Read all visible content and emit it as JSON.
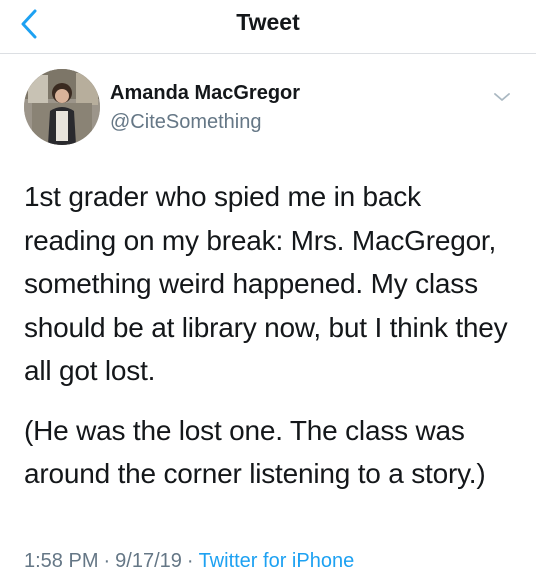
{
  "header": {
    "title": "Tweet",
    "back_icon": "chevron-left-icon",
    "accent_color": "#1da1f2"
  },
  "author": {
    "name": "Amanda MacGregor",
    "handle": "@CiteSomething",
    "menu_icon": "chevron-down-icon"
  },
  "tweet": {
    "paragraphs": [
      "1st grader who spied me in back reading on my break: Mrs. MacGregor, something weird happened. My class should be at library now, but I think they all got lost.",
      "(He was the lost one. The class was around the corner listening to a story.)"
    ]
  },
  "meta": {
    "time": "1:58 PM",
    "separator": "·",
    "date": "9/17/19",
    "source": "Twitter for iPhone"
  }
}
